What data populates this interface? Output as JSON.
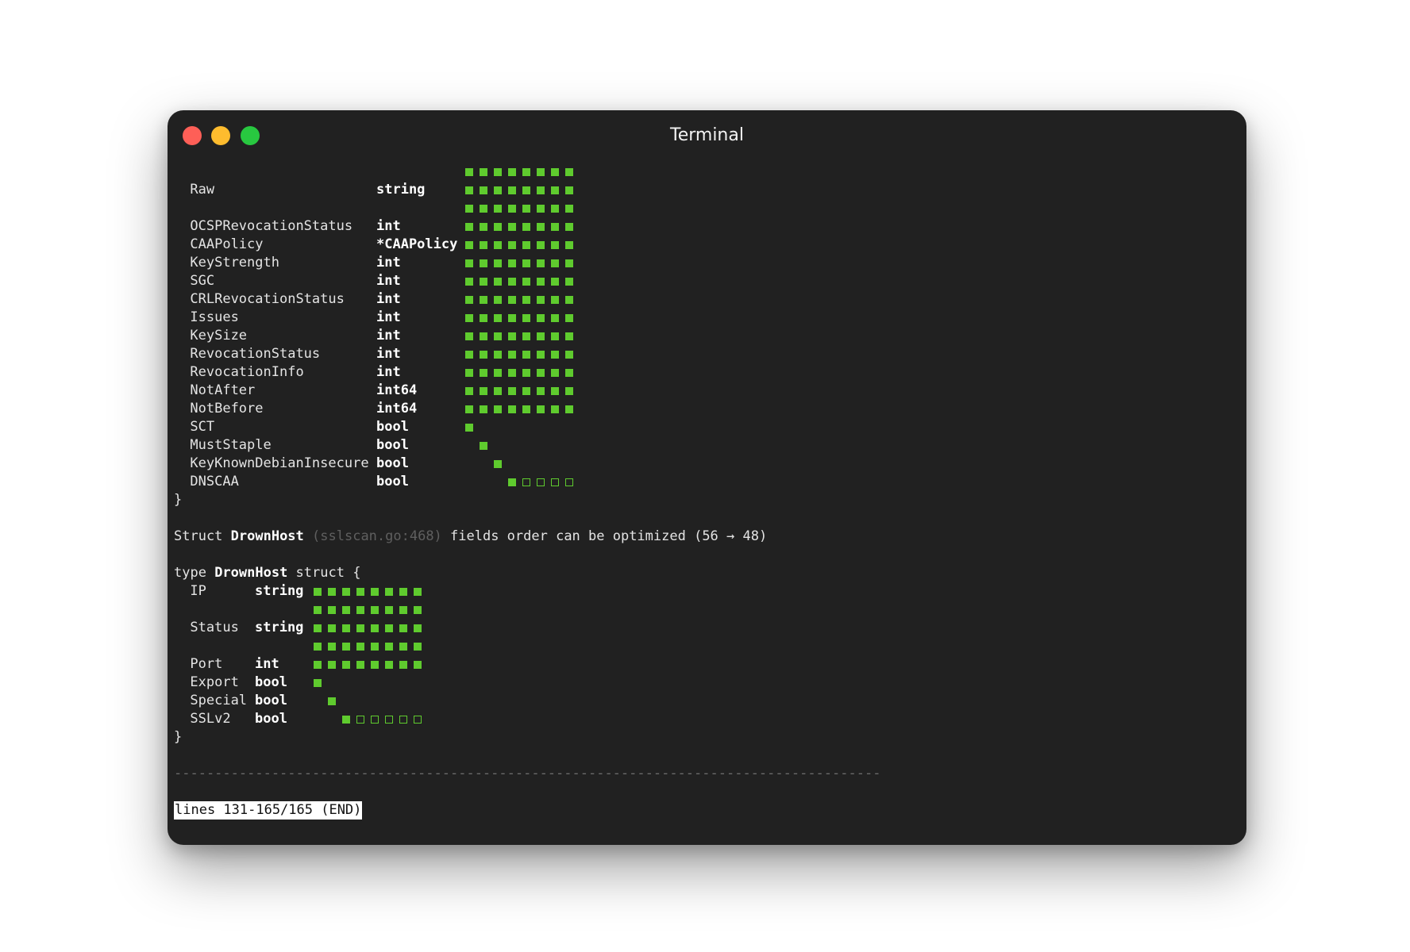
{
  "window": {
    "title": "Terminal"
  },
  "colors": {
    "background": "#212121",
    "cell": "#5fcb2e",
    "text": "#e4e4e4"
  },
  "struct1_fields": [
    {
      "name": "",
      "type": "",
      "cells": {
        "start": 0,
        "filled": 8,
        "pad": 0
      }
    },
    {
      "name": "Raw",
      "type": "string",
      "cells": {
        "start": 0,
        "filled": 8,
        "pad": 0
      }
    },
    {
      "name": "",
      "type": "",
      "cells": {
        "start": 0,
        "filled": 8,
        "pad": 0
      }
    },
    {
      "name": "OCSPRevocationStatus",
      "type": "int",
      "cells": {
        "start": 0,
        "filled": 8,
        "pad": 0
      }
    },
    {
      "name": "CAAPolicy",
      "type": "*CAAPolicy",
      "cells": {
        "start": 0,
        "filled": 8,
        "pad": 0
      }
    },
    {
      "name": "KeyStrength",
      "type": "int",
      "cells": {
        "start": 0,
        "filled": 8,
        "pad": 0
      }
    },
    {
      "name": "SGC",
      "type": "int",
      "cells": {
        "start": 0,
        "filled": 8,
        "pad": 0
      }
    },
    {
      "name": "CRLRevocationStatus",
      "type": "int",
      "cells": {
        "start": 0,
        "filled": 8,
        "pad": 0
      }
    },
    {
      "name": "Issues",
      "type": "int",
      "cells": {
        "start": 0,
        "filled": 8,
        "pad": 0
      }
    },
    {
      "name": "KeySize",
      "type": "int",
      "cells": {
        "start": 0,
        "filled": 8,
        "pad": 0
      }
    },
    {
      "name": "RevocationStatus",
      "type": "int",
      "cells": {
        "start": 0,
        "filled": 8,
        "pad": 0
      }
    },
    {
      "name": "RevocationInfo",
      "type": "int",
      "cells": {
        "start": 0,
        "filled": 8,
        "pad": 0
      }
    },
    {
      "name": "NotAfter",
      "type": "int64",
      "cells": {
        "start": 0,
        "filled": 8,
        "pad": 0
      }
    },
    {
      "name": "NotBefore",
      "type": "int64",
      "cells": {
        "start": 0,
        "filled": 8,
        "pad": 0
      }
    },
    {
      "name": "SCT",
      "type": "bool",
      "cells": {
        "start": 0,
        "filled": 1,
        "pad": 0
      }
    },
    {
      "name": "MustStaple",
      "type": "bool",
      "cells": {
        "start": 1,
        "filled": 1,
        "pad": 0
      }
    },
    {
      "name": "KeyKnownDebianInsecure",
      "type": "bool",
      "cells": {
        "start": 2,
        "filled": 1,
        "pad": 0
      }
    },
    {
      "name": "DNSCAA",
      "type": "bool",
      "cells": {
        "start": 3,
        "filled": 1,
        "pad": 4
      }
    }
  ],
  "closing_brace": "}",
  "message": {
    "prefix": "Struct ",
    "struct_name": "DrownHost",
    "location": "(sslscan.go:468)",
    "text": " fields order can be optimized (56 → 48)"
  },
  "struct2_header": {
    "keyword": "type ",
    "name": "DrownHost",
    "rest": " struct {"
  },
  "struct2_fields": [
    {
      "name": "IP",
      "type": "string",
      "cells": {
        "start": 0,
        "filled": 8,
        "pad": 0
      }
    },
    {
      "name": "",
      "type": "",
      "cells": {
        "start": 0,
        "filled": 8,
        "pad": 0
      }
    },
    {
      "name": "Status",
      "type": "string",
      "cells": {
        "start": 0,
        "filled": 8,
        "pad": 0
      }
    },
    {
      "name": "",
      "type": "",
      "cells": {
        "start": 0,
        "filled": 8,
        "pad": 0
      }
    },
    {
      "name": "Port",
      "type": "int",
      "cells": {
        "start": 0,
        "filled": 8,
        "pad": 0
      }
    },
    {
      "name": "Export",
      "type": "bool",
      "cells": {
        "start": 0,
        "filled": 1,
        "pad": 0
      }
    },
    {
      "name": "Special",
      "type": "bool",
      "cells": {
        "start": 1,
        "filled": 1,
        "pad": 0
      }
    },
    {
      "name": "SSLv2",
      "type": "bool",
      "cells": {
        "start": 2,
        "filled": 1,
        "pad": 5
      }
    }
  ],
  "separator": "---------------------------------------------------------------------------------------",
  "status_bar": "lines 131-165/165 (END)"
}
